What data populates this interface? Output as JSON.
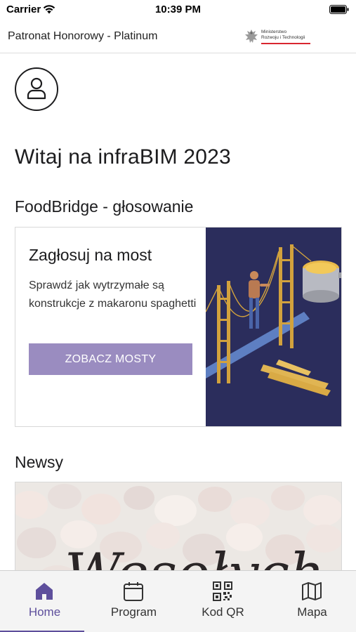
{
  "status_bar": {
    "carrier": "Carrier",
    "time": "10:39 PM"
  },
  "sponsor": {
    "text": "Patronat Honorowy - Platinum",
    "logo_line1": "Ministerstwo",
    "logo_line2": "Rozwoju i Technologii"
  },
  "welcome": {
    "title": "Witaj na infraBIM 2023"
  },
  "foodbridge": {
    "heading": "FoodBridge - głosowanie",
    "card_title": "Zagłosuj na most",
    "card_description": "Sprawdź jak wytrzymałe są konstrukcje z makaronu spaghetti",
    "button_label": "ZOBACZ MOSTY"
  },
  "news": {
    "heading": "Newsy",
    "image_text": "Wesołych"
  },
  "tabs": [
    {
      "label": "Home",
      "icon": "home-icon",
      "active": true
    },
    {
      "label": "Program",
      "icon": "calendar-icon",
      "active": false
    },
    {
      "label": "Kod QR",
      "icon": "qr-code-icon",
      "active": false
    },
    {
      "label": "Mapa",
      "icon": "map-icon",
      "active": false
    }
  ],
  "colors": {
    "accent": "#5e4f9c",
    "button": "#9a8cc0",
    "illustration_bg": "#2b2d5c",
    "logo_line": "#d8262f"
  }
}
